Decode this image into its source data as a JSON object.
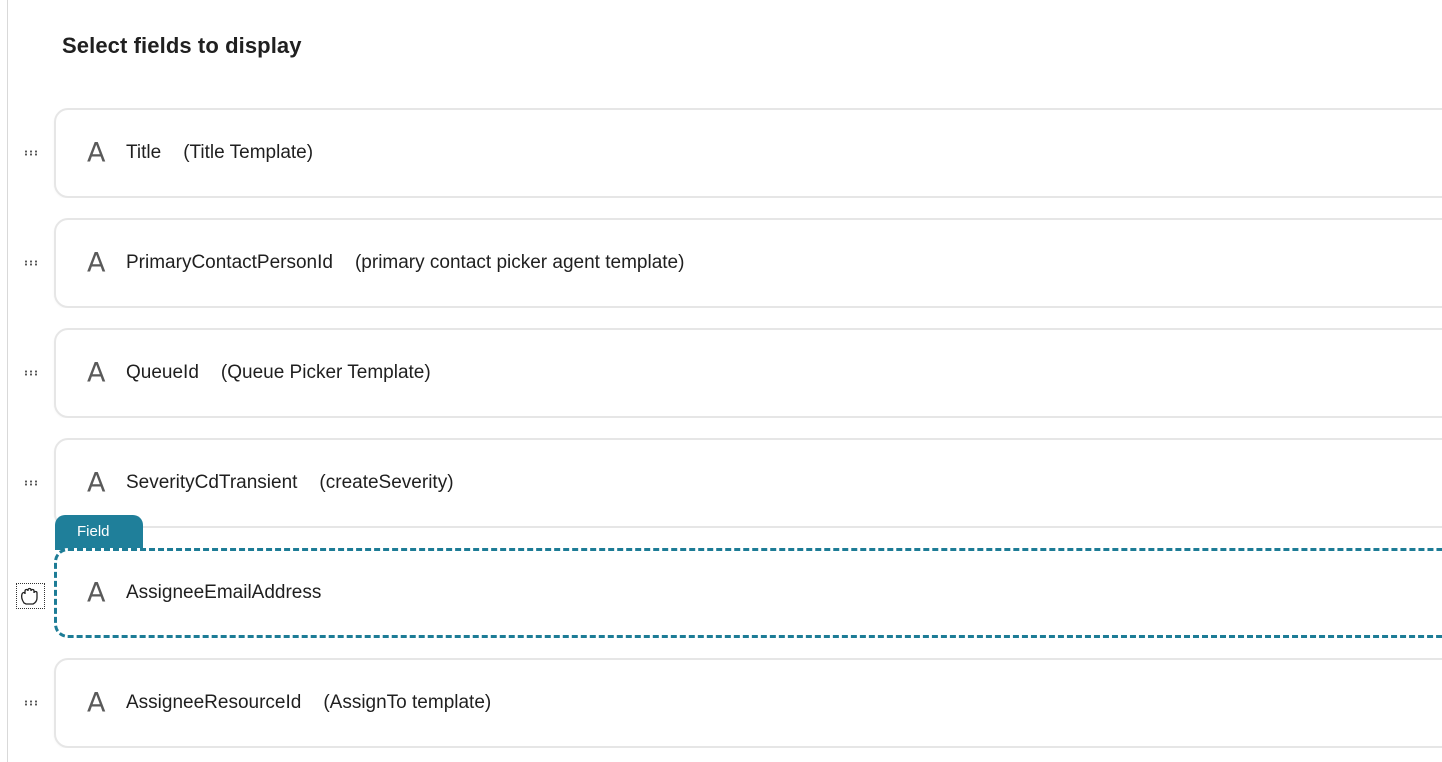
{
  "heading": "Select fields to display",
  "field_tag": "Field",
  "fields": [
    {
      "name": "Title",
      "template": "(Title Template)",
      "icon": "text-field-icon"
    },
    {
      "name": "PrimaryContactPersonId",
      "template": "(primary contact picker agent template)",
      "icon": "text-field-icon"
    },
    {
      "name": "QueueId",
      "template": "(Queue Picker Template)",
      "icon": "text-field-icon"
    },
    {
      "name": "SeverityCdTransient",
      "template": "(createSeverity)",
      "icon": "text-field-icon"
    },
    {
      "name": "AssigneeEmailAddress",
      "template": "",
      "icon": "text-field-icon",
      "selected": true
    },
    {
      "name": "AssigneeResourceId",
      "template": "(AssignTo template)",
      "icon": "text-field-icon"
    }
  ],
  "icon_glyph": "A",
  "colors": {
    "accent": "#1f7f9a",
    "row_border": "#e6e6e6"
  }
}
